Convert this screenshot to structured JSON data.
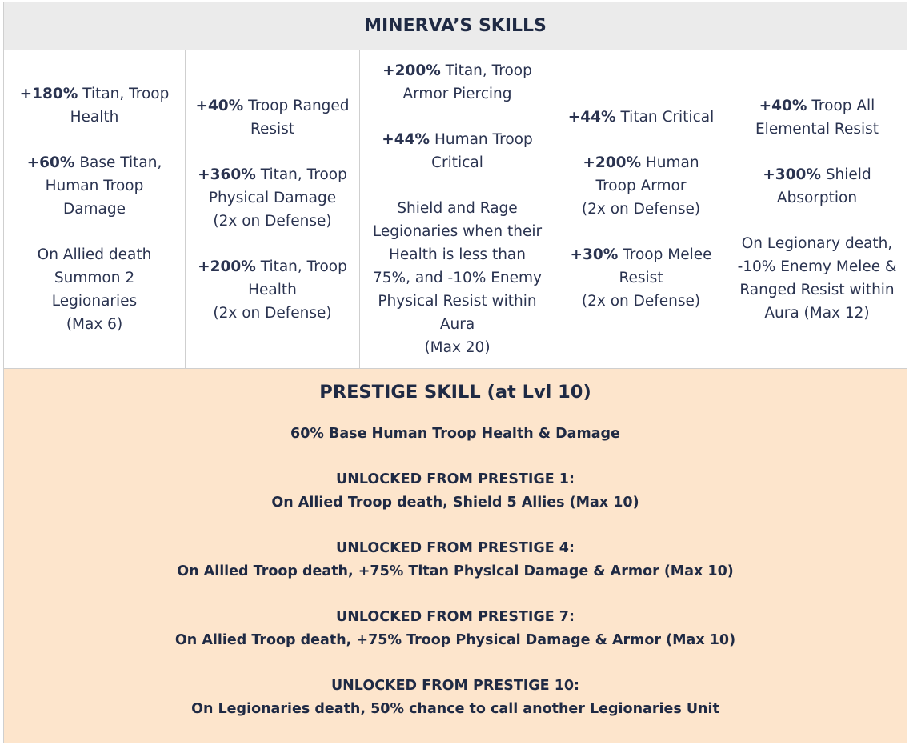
{
  "title": "MINERVA’S SKILLS",
  "columns": [
    {
      "paragraphs": [
        {
          "bold": "+180%",
          "text": " Titan, Troop Health"
        },
        {
          "bold": "+60%",
          "text": " Base Titan, Human Troop Damage"
        },
        {
          "bold": "",
          "text": "On Allied death Summon 2 Legionaries",
          "extra": "(Max 6)"
        }
      ]
    },
    {
      "paragraphs": [
        {
          "bold": "+40%",
          "text": " Troop Ranged Resist"
        },
        {
          "bold": "+360%",
          "text": " Titan, Troop Physical Damage",
          "extra": "(2x on Defense)"
        },
        {
          "bold": "+200%",
          "text": " Titan, Troop Health",
          "extra": "(2x on Defense)"
        }
      ]
    },
    {
      "paragraphs": [
        {
          "bold": "+200%",
          "text": " Titan, Troop Armor Piercing"
        },
        {
          "bold": "+44%",
          "text": " Human Troop Critical"
        },
        {
          "bold": "",
          "text": "Shield and Rage Legionaries when their Health is less than 75%, and -10% Enemy Physical Resist within Aura",
          "extra": "(Max 20)"
        }
      ]
    },
    {
      "paragraphs": [
        {
          "bold": "+44%",
          "text": " Titan Critical"
        },
        {
          "bold": "+200%",
          "text": " Human Troop Armor",
          "extra": "(2x on Defense)"
        },
        {
          "bold": "+30%",
          "text": " Troop Melee Resist",
          "extra": "(2x on Defense)"
        }
      ]
    },
    {
      "paragraphs": [
        {
          "bold": "+40%",
          "text": " Troop All Elemental Resist"
        },
        {
          "bold": "+300%",
          "text": " Shield Absorption"
        },
        {
          "bold": "",
          "text": "On Legionary death, -10% Enemy Melee & Ranged Resist within Aura (Max 12)"
        }
      ]
    }
  ],
  "prestige": {
    "title": "PRESTIGE SKILL (at Lvl 10)",
    "base": "60% Base Human Troop Health & Damage",
    "unlocks": [
      {
        "label": "UNLOCKED FROM PRESTIGE 1:",
        "text": "On Allied Troop death, Shield 5 Allies (Max 10)"
      },
      {
        "label": "UNLOCKED FROM PRESTIGE 4:",
        "text": "On Allied Troop death, +75% Titan Physical Damage & Armor (Max 10)"
      },
      {
        "label": "UNLOCKED FROM PRESTIGE 7:",
        "text": "On Allied Troop death, +75% Troop Physical Damage & Armor (Max 10)"
      },
      {
        "label": "UNLOCKED FROM PRESTIGE 10:",
        "text": "On Legionaries death, 50% chance to call another Legionaries Unit"
      }
    ]
  }
}
